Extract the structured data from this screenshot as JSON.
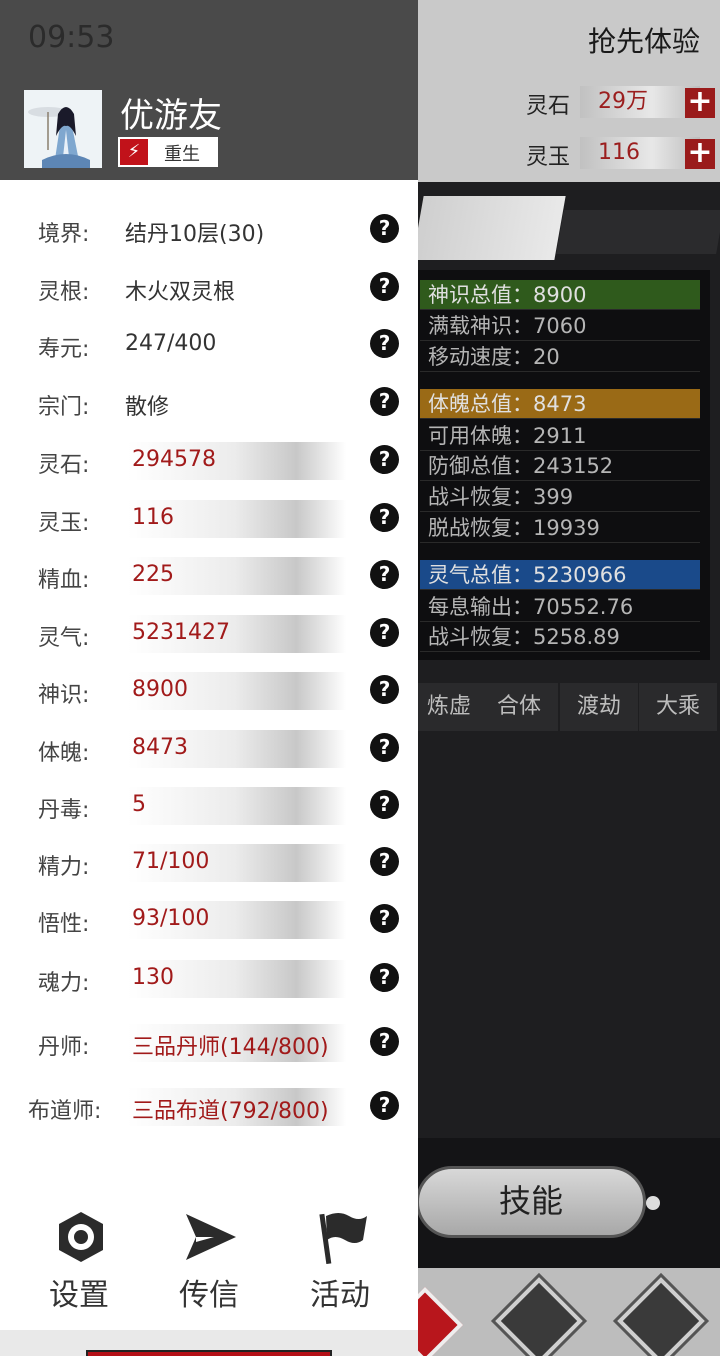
{
  "status": {
    "time": "09:53"
  },
  "header": {
    "title": "抢先体验"
  },
  "currencies": [
    {
      "label": "灵石",
      "value": "29万"
    },
    {
      "label": "灵玉",
      "value": "116"
    }
  ],
  "stat_panel": {
    "groups": [
      {
        "head": "神识总值：8900",
        "color": "#2f5a1c",
        "lines": [
          "满载神识：7060",
          "移动速度：20"
        ]
      },
      {
        "head": "体魄总值：8473",
        "color": "#9a6a16",
        "lines": [
          "可用体魄：2911",
          "防御总值：243152",
          "战斗恢复：399",
          "脱战恢复：19939"
        ]
      },
      {
        "head": "灵气总值：5230966",
        "color": "#1a4a8a",
        "lines": [
          "每息输出：70552.76",
          "战斗恢复：5258.89"
        ]
      }
    ]
  },
  "realm_tabs": [
    "炼虚",
    "合体",
    "渡劫",
    "大乘"
  ],
  "skill_button": "技能",
  "player": {
    "name": "优游友",
    "tag": "重生"
  },
  "attributes": [
    {
      "label": "境界:",
      "value": "结丹10层(30)",
      "bar": false
    },
    {
      "label": "灵根:",
      "value": "木火双灵根",
      "bar": false
    },
    {
      "label": "寿元:",
      "value": "247/400",
      "bar": false
    },
    {
      "label": "宗门:",
      "value": "散修",
      "bar": false
    },
    {
      "label": "灵石:",
      "value": "294578",
      "bar": true
    },
    {
      "label": "灵玉:",
      "value": "116",
      "bar": true
    },
    {
      "label": "精血:",
      "value": "225",
      "bar": true
    },
    {
      "label": "灵气:",
      "value": "5231427",
      "bar": true
    },
    {
      "label": "神识:",
      "value": "8900",
      "bar": true
    },
    {
      "label": "体魄:",
      "value": "8473",
      "bar": true
    },
    {
      "label": "丹毒:",
      "value": "5",
      "bar": true
    },
    {
      "label": "精力:",
      "value": "71/100",
      "bar": true
    },
    {
      "label": "悟性:",
      "value": "93/100",
      "bar": true
    },
    {
      "label": "魂力:",
      "value": "130",
      "bar": true
    },
    {
      "label": "丹师:",
      "value": "三品丹师(144/800)",
      "bar": true
    },
    {
      "label": "布道师:",
      "value": "三品布道(792/800)",
      "bar": true
    }
  ],
  "footer": [
    {
      "label": "设置",
      "icon": "gear-icon"
    },
    {
      "label": "传信",
      "icon": "send-icon"
    },
    {
      "label": "活动",
      "icon": "flag-icon"
    }
  ],
  "help_glyph": "?",
  "bolt_glyph": "⚡",
  "plus_glyph": "+"
}
